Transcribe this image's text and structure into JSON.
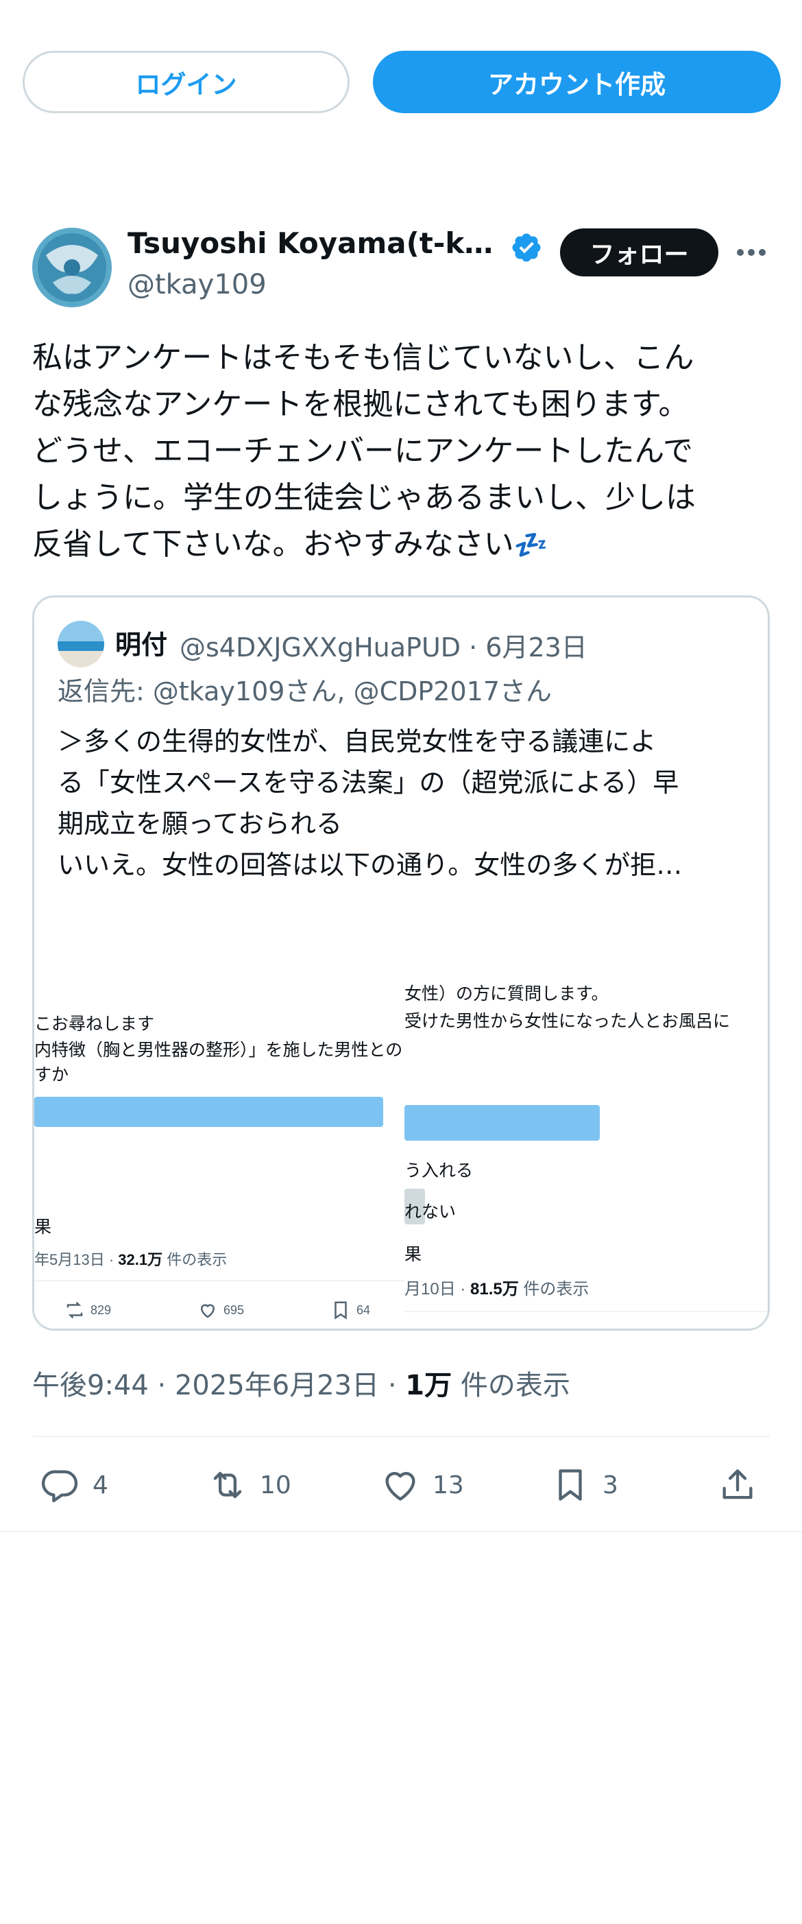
{
  "top_buttons": {
    "login": "ログイン",
    "create_account": "アカウント作成"
  },
  "tweet": {
    "author_name": "Tsuyoshi Koyama(t-k…",
    "author_handle": "@tkay109",
    "follow_label": "フォロー",
    "text_lines": [
      "私はアンケートはそもそも信じていないし、こん",
      "な残念なアンケートを根拠にされても困ります。",
      "どうせ、エコーチェンバーにアンケートしたんで",
      "しょうに。学生の生徒会じゃあるまいし、少しは",
      "反省して下さいな。おやすみなさい"
    ],
    "emoji": "💤",
    "time": "午後9:44",
    "date": "2025年6月23日",
    "views_count": "1万",
    "views_label": "件の表示",
    "actions": {
      "reply": "4",
      "retweet": "10",
      "like": "13",
      "bookmark": "3"
    }
  },
  "quote": {
    "name": "明付",
    "handle_date": "@s4DXJGXXgHuaPUD · 6月23日",
    "reply_to": "返信先: @tkay109さん, @CDP2017さん",
    "text_lines": [
      "＞多くの生得的女性が、自民党女性を守る議連によ",
      "る「女性スペースを守る法案」の（超党派による）早",
      "期成立を願っておられる",
      "いいえ。女性の回答は以下の通り。女性の多くが拒…"
    ],
    "images": {
      "left": {
        "line1": "こお尋ねします",
        "line2": "内特徴（胸と男性器の整形）」を施した男性との",
        "line3": "すか",
        "result": "果",
        "meta_date": "年5月13日 · ",
        "meta_views": "32.1万",
        "meta_label": " 件の表示",
        "retweets": "829",
        "likes": "695",
        "bookmarks": "64",
        "bar_fraction": 0.97
      },
      "right": {
        "line1": "女性）の方に質問します。",
        "line2": "受けた男性から女性になった人とお風呂に",
        "option1": "う入れる",
        "option2": "れない",
        "result": "果",
        "meta_date": "月10日 · ",
        "meta_views": "81.5万",
        "meta_label": " 件の表示"
      }
    }
  },
  "colors": {
    "accent": "#1d9bf0",
    "text": "#0f1419",
    "secondary": "#536471",
    "border": "#cfd9de"
  }
}
